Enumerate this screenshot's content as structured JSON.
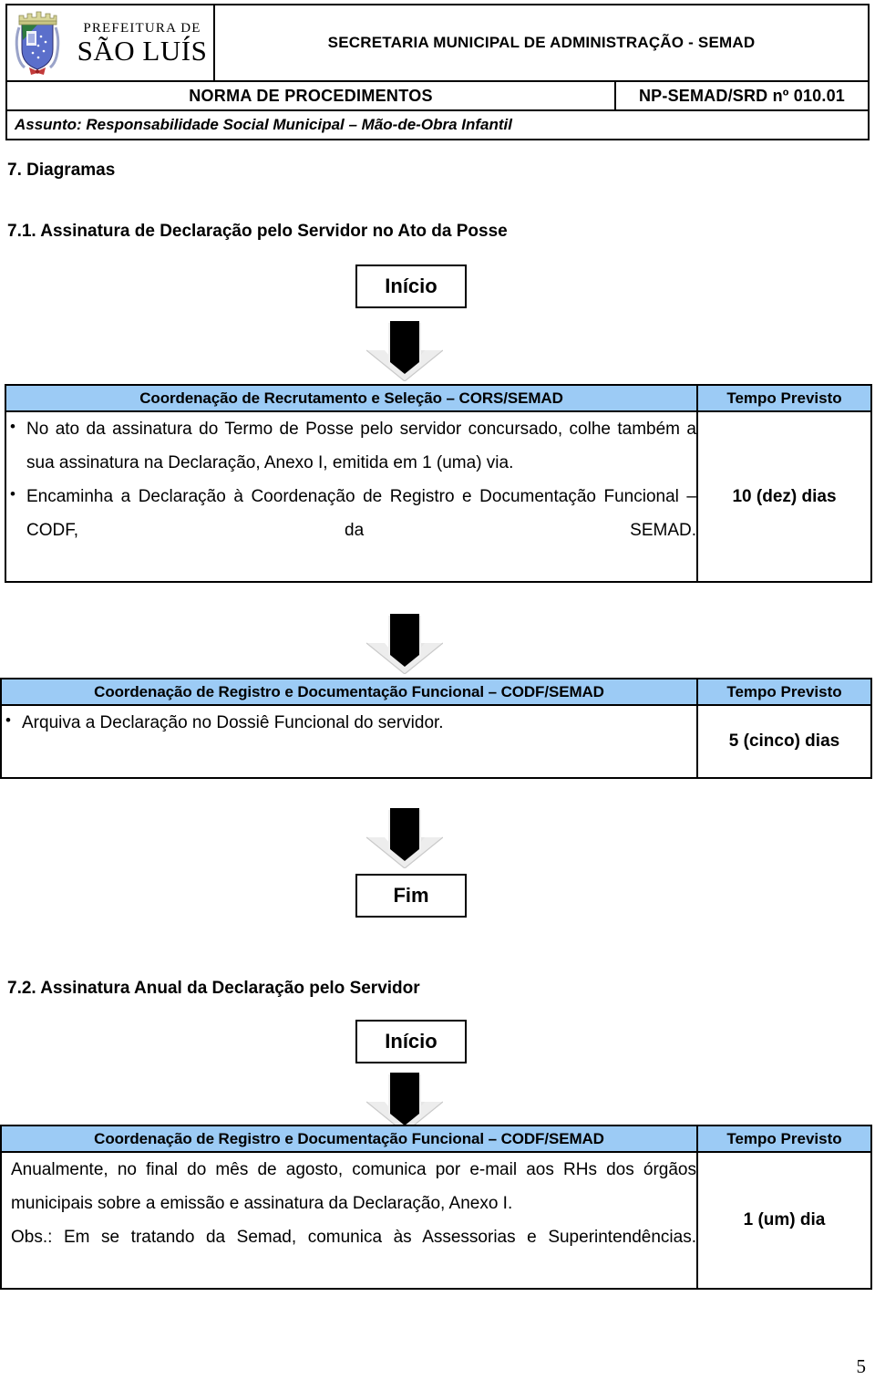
{
  "header": {
    "logo": {
      "crest_alt": "brasao-sao-luis",
      "line1": "PREFEITURA DE",
      "line2": "SÃO LUÍS"
    },
    "organization": "SECRETARIA MUNICIPAL DE ADMINISTRAÇÃO - SEMAD",
    "norm_label": "NORMA DE PROCEDIMENTOS",
    "norm_code": "NP-SEMAD/SRD nº 010.01",
    "subject": "Assunto: Responsabilidade Social Municipal – Mão-de-Obra Infantil"
  },
  "headings": {
    "section_7": "7. Diagramas",
    "section_71": "7.1. Assinatura de Declaração pelo Servidor no Ato da Posse",
    "section_72": "7.2. Assinatura Anual da Declaração pelo Servidor"
  },
  "terminators": {
    "start_1": "Início",
    "end_1": "Fim",
    "start_2": "Início"
  },
  "column_headers": {
    "time": "Tempo Previsto"
  },
  "flows": [
    {
      "id": "flow-71",
      "steps": [
        {
          "actor": "Coordenação de Recrutamento e Seleção – CORS/SEMAD",
          "time_header": "Tempo Previsto",
          "time_value": "10 (dez) dias",
          "actions": [
            "No ato da assinatura do Termo de Posse pelo servidor concursado, colhe também a sua assinatura na Declaração, Anexo I, emitida em 1 (uma) via.",
            "Encaminha a Declaração à Coordenação de Registro e Documentação Funcional – CODF, da SEMAD."
          ]
        },
        {
          "actor": "Coordenação de Registro e Documentação Funcional – CODF/SEMAD",
          "time_header": "Tempo Previsto",
          "time_value": "5 (cinco) dias",
          "actions": [
            "Arquiva a Declaração no Dossiê Funcional do servidor."
          ]
        }
      ]
    },
    {
      "id": "flow-72",
      "steps": [
        {
          "actor": "Coordenação de Registro e Documentação Funcional – CODF/SEMAD",
          "time_header": "Tempo Previsto",
          "time_value": "1 (um) dia",
          "paragraphs": [
            "Anualmente, no final do mês de agosto, comunica por e-mail aos RHs dos órgãos municipais sobre a emissão e assinatura da Declaração, Anexo I.",
            "Obs.: Em se tratando da Semad, comunica às Assessorias e Superintendências."
          ]
        }
      ]
    }
  ],
  "page_number": "5",
  "colors": {
    "table_header_blue": "#9CCBF5",
    "border_black": "#000000",
    "arrow_body": "#000000",
    "arrow_head": "#E3E3E3"
  }
}
